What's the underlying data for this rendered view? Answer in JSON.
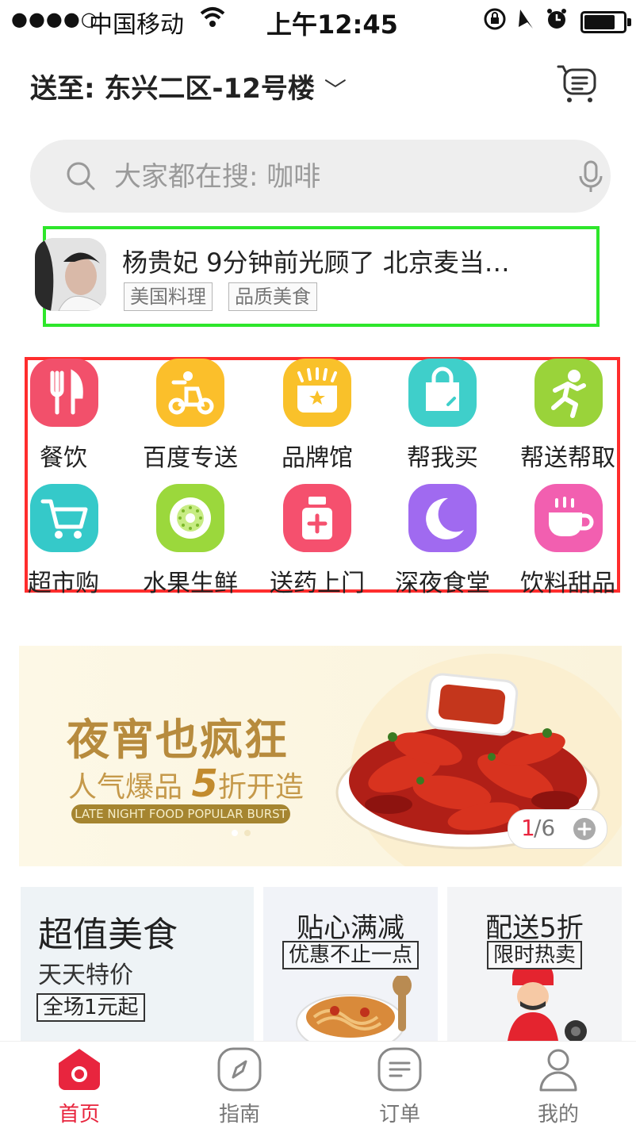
{
  "status_bar": {
    "signal": "●●●●○",
    "carrier": "中国移动",
    "time": "上午12:45"
  },
  "header": {
    "address": "送至: 东兴二区-12号楼"
  },
  "search": {
    "placeholder": "大家都在搜: 咖啡"
  },
  "ticker": {
    "text": "杨贵妃 9分钟前光顾了 北京麦当…",
    "tags": [
      "美国料理",
      "品质美食"
    ]
  },
  "categories": [
    {
      "label": "餐饮",
      "icon": "utensils-icon",
      "color": "#f2506b"
    },
    {
      "label": "百度专送",
      "icon": "delivery-scooter-icon",
      "color": "#fbbf2b"
    },
    {
      "label": "品牌馆",
      "icon": "brand-store-icon",
      "color": "#f9c12a"
    },
    {
      "label": "帮我买",
      "icon": "shopping-bag-icon",
      "color": "#3fcfca"
    },
    {
      "label": "帮送帮取",
      "icon": "runner-icon",
      "color": "#9ad33a"
    },
    {
      "label": "超市购",
      "icon": "shopping-cart-icon",
      "color": "#35c9c9"
    },
    {
      "label": "水果生鲜",
      "icon": "kiwi-icon",
      "color": "#9bd83c"
    },
    {
      "label": "送药上门",
      "icon": "medicine-bottle-icon",
      "color": "#f5506e"
    },
    {
      "label": "深夜食堂",
      "icon": "moon-icon",
      "color": "#a06af0"
    },
    {
      "label": "饮料甜品",
      "icon": "coffee-cup-icon",
      "color": "#f25fb0"
    }
  ],
  "banner": {
    "title": "夜宵也疯狂",
    "subtitle_prefix": "人气爆品",
    "subtitle_number": "5",
    "subtitle_suffix": "折开造",
    "english": "LATE NIGHT FOOD POPULAR BURST",
    "pager_current": "1",
    "pager_total": "/6"
  },
  "promo_cards": [
    {
      "title": "超值美食",
      "subtitle": "天天特价",
      "box": "全场1元起"
    },
    {
      "title": "贴心满减",
      "box": "优惠不止一点"
    },
    {
      "title": "配送5折",
      "box": "限时热卖"
    }
  ],
  "tabs": [
    {
      "label": "首页",
      "icon": "home-icon",
      "active": true
    },
    {
      "label": "指南",
      "icon": "compass-icon",
      "active": false
    },
    {
      "label": "订单",
      "icon": "order-list-icon",
      "active": false
    },
    {
      "label": "我的",
      "icon": "user-icon",
      "active": false
    }
  ],
  "colors": {
    "accent": "#e8253e",
    "highlight_green": "#2ee62b",
    "highlight_red": "#ff2d2d",
    "banner_gold": "#b78b3d"
  }
}
